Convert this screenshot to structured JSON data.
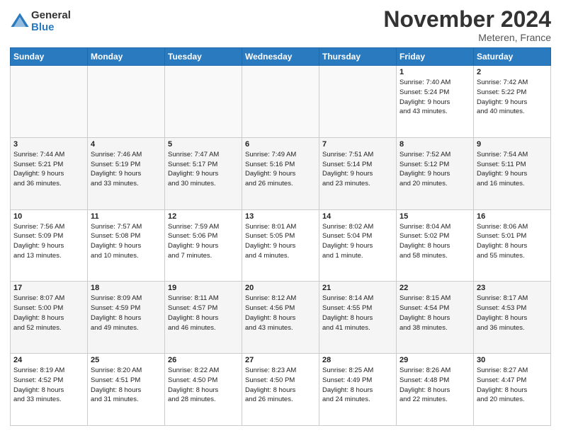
{
  "logo": {
    "general": "General",
    "blue": "Blue"
  },
  "title": "November 2024",
  "location": "Meteren, France",
  "days_of_week": [
    "Sunday",
    "Monday",
    "Tuesday",
    "Wednesday",
    "Thursday",
    "Friday",
    "Saturday"
  ],
  "weeks": [
    [
      {
        "day": "",
        "info": ""
      },
      {
        "day": "",
        "info": ""
      },
      {
        "day": "",
        "info": ""
      },
      {
        "day": "",
        "info": ""
      },
      {
        "day": "",
        "info": ""
      },
      {
        "day": "1",
        "info": "Sunrise: 7:40 AM\nSunset: 5:24 PM\nDaylight: 9 hours\nand 43 minutes."
      },
      {
        "day": "2",
        "info": "Sunrise: 7:42 AM\nSunset: 5:22 PM\nDaylight: 9 hours\nand 40 minutes."
      }
    ],
    [
      {
        "day": "3",
        "info": "Sunrise: 7:44 AM\nSunset: 5:21 PM\nDaylight: 9 hours\nand 36 minutes."
      },
      {
        "day": "4",
        "info": "Sunrise: 7:46 AM\nSunset: 5:19 PM\nDaylight: 9 hours\nand 33 minutes."
      },
      {
        "day": "5",
        "info": "Sunrise: 7:47 AM\nSunset: 5:17 PM\nDaylight: 9 hours\nand 30 minutes."
      },
      {
        "day": "6",
        "info": "Sunrise: 7:49 AM\nSunset: 5:16 PM\nDaylight: 9 hours\nand 26 minutes."
      },
      {
        "day": "7",
        "info": "Sunrise: 7:51 AM\nSunset: 5:14 PM\nDaylight: 9 hours\nand 23 minutes."
      },
      {
        "day": "8",
        "info": "Sunrise: 7:52 AM\nSunset: 5:12 PM\nDaylight: 9 hours\nand 20 minutes."
      },
      {
        "day": "9",
        "info": "Sunrise: 7:54 AM\nSunset: 5:11 PM\nDaylight: 9 hours\nand 16 minutes."
      }
    ],
    [
      {
        "day": "10",
        "info": "Sunrise: 7:56 AM\nSunset: 5:09 PM\nDaylight: 9 hours\nand 13 minutes."
      },
      {
        "day": "11",
        "info": "Sunrise: 7:57 AM\nSunset: 5:08 PM\nDaylight: 9 hours\nand 10 minutes."
      },
      {
        "day": "12",
        "info": "Sunrise: 7:59 AM\nSunset: 5:06 PM\nDaylight: 9 hours\nand 7 minutes."
      },
      {
        "day": "13",
        "info": "Sunrise: 8:01 AM\nSunset: 5:05 PM\nDaylight: 9 hours\nand 4 minutes."
      },
      {
        "day": "14",
        "info": "Sunrise: 8:02 AM\nSunset: 5:04 PM\nDaylight: 9 hours\nand 1 minute."
      },
      {
        "day": "15",
        "info": "Sunrise: 8:04 AM\nSunset: 5:02 PM\nDaylight: 8 hours\nand 58 minutes."
      },
      {
        "day": "16",
        "info": "Sunrise: 8:06 AM\nSunset: 5:01 PM\nDaylight: 8 hours\nand 55 minutes."
      }
    ],
    [
      {
        "day": "17",
        "info": "Sunrise: 8:07 AM\nSunset: 5:00 PM\nDaylight: 8 hours\nand 52 minutes."
      },
      {
        "day": "18",
        "info": "Sunrise: 8:09 AM\nSunset: 4:59 PM\nDaylight: 8 hours\nand 49 minutes."
      },
      {
        "day": "19",
        "info": "Sunrise: 8:11 AM\nSunset: 4:57 PM\nDaylight: 8 hours\nand 46 minutes."
      },
      {
        "day": "20",
        "info": "Sunrise: 8:12 AM\nSunset: 4:56 PM\nDaylight: 8 hours\nand 43 minutes."
      },
      {
        "day": "21",
        "info": "Sunrise: 8:14 AM\nSunset: 4:55 PM\nDaylight: 8 hours\nand 41 minutes."
      },
      {
        "day": "22",
        "info": "Sunrise: 8:15 AM\nSunset: 4:54 PM\nDaylight: 8 hours\nand 38 minutes."
      },
      {
        "day": "23",
        "info": "Sunrise: 8:17 AM\nSunset: 4:53 PM\nDaylight: 8 hours\nand 36 minutes."
      }
    ],
    [
      {
        "day": "24",
        "info": "Sunrise: 8:19 AM\nSunset: 4:52 PM\nDaylight: 8 hours\nand 33 minutes."
      },
      {
        "day": "25",
        "info": "Sunrise: 8:20 AM\nSunset: 4:51 PM\nDaylight: 8 hours\nand 31 minutes."
      },
      {
        "day": "26",
        "info": "Sunrise: 8:22 AM\nSunset: 4:50 PM\nDaylight: 8 hours\nand 28 minutes."
      },
      {
        "day": "27",
        "info": "Sunrise: 8:23 AM\nSunset: 4:50 PM\nDaylight: 8 hours\nand 26 minutes."
      },
      {
        "day": "28",
        "info": "Sunrise: 8:25 AM\nSunset: 4:49 PM\nDaylight: 8 hours\nand 24 minutes."
      },
      {
        "day": "29",
        "info": "Sunrise: 8:26 AM\nSunset: 4:48 PM\nDaylight: 8 hours\nand 22 minutes."
      },
      {
        "day": "30",
        "info": "Sunrise: 8:27 AM\nSunset: 4:47 PM\nDaylight: 8 hours\nand 20 minutes."
      }
    ]
  ]
}
